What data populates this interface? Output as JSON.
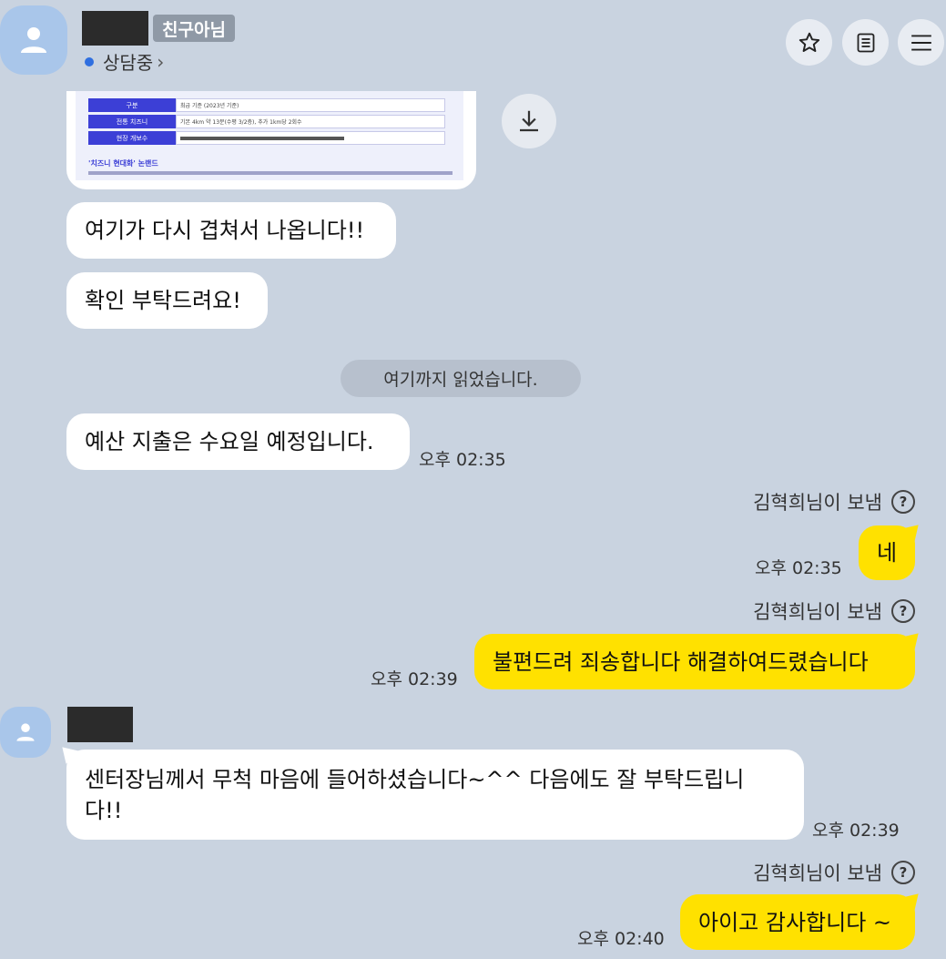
{
  "header": {
    "friend_badge": "친구아님",
    "status_text": "상담중",
    "status_chevron": "›",
    "icons": [
      "star-icon",
      "list-icon",
      "menu-icon"
    ]
  },
  "attachment": {
    "doc_title": "'치즈니 현대화' 논랜드",
    "row1_label": "구분",
    "row1_text": "최급 기준 (2023년 기준)",
    "row2_label": "전통 치즈니",
    "row2_text": "기본 4km 약 13분(수평 3/2층), 추가 1km당 2회수",
    "row3_label": "현장 개보수"
  },
  "read_divider": "여기까지 읽었습니다.",
  "messages": {
    "m1": "여기가 다시 겹쳐서 나옵니다!!",
    "m2": "확인 부탁드려요!",
    "m3": "예산 지출은 수요일 예정입니다.",
    "m3_time": "오후 02:35",
    "sender1": "김혁희님이 보냄",
    "m4": "네",
    "m4_time": "오후 02:35",
    "sender2": "김혁희님이 보냄",
    "m5": "불편드려 죄송합니다 해결하여드렸습니다",
    "m5_time": "오후 02:39",
    "m6_line1": "센터장님께서 무척 마음에 들어하셨습니다~^^ 다음에도 잘 부탁드립니",
    "m6_line2": "다!!",
    "m6_time": "오후 02:39",
    "sender3": "김혁희님이 보냄",
    "m7": "아이고 감사합니다 ~",
    "m7_time": "오후 02:40"
  },
  "colors": {
    "background": "#c9d3e0",
    "my_bubble": "#ffe100",
    "other_bubble": "#ffffff",
    "status_dot": "#2f6fe0"
  }
}
